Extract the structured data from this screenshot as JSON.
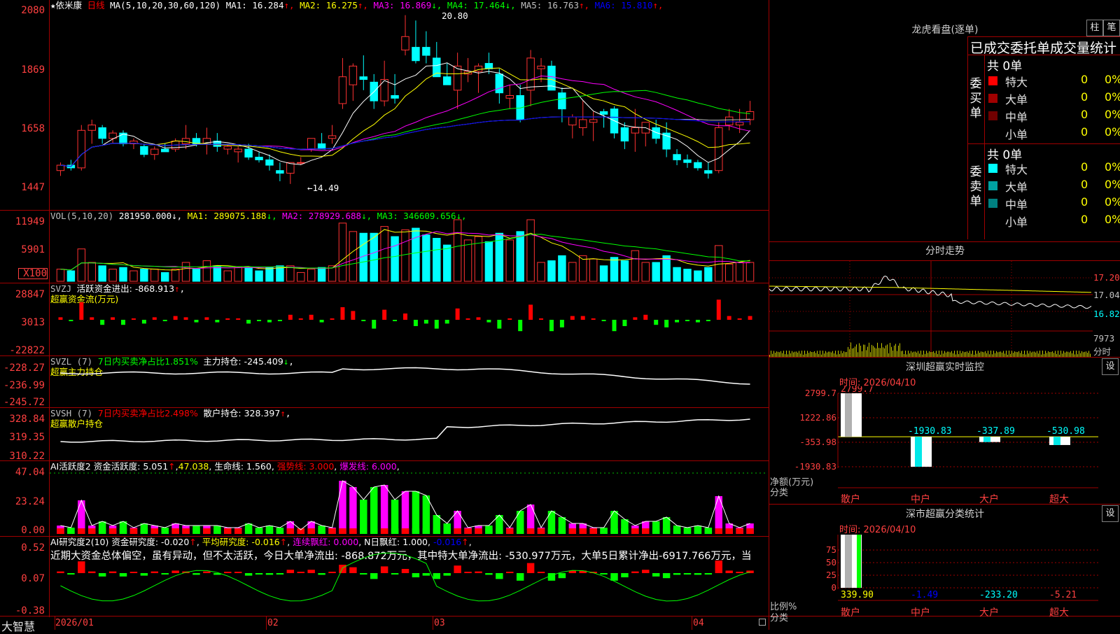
{
  "stock": {
    "star": "★",
    "name": "依米康",
    "period": "日线"
  },
  "main_pane": {
    "y_ticks": [
      "2080",
      "1869",
      "1658",
      "1447"
    ],
    "ma_label": "MA(5,10,20,30,60,120)",
    "ma": [
      {
        "label": "MA1:",
        "value": "16.284",
        "arrow": "↑",
        "color": "#ffffff"
      },
      {
        "label": "MA2:",
        "value": "16.275",
        "arrow": "↑",
        "color": "#ffff00"
      },
      {
        "label": "MA3:",
        "value": "16.869",
        "arrow": "↓",
        "color": "#ff00ff"
      },
      {
        "label": "MA4:",
        "value": "17.464",
        "arrow": "↓",
        "color": "#00ff00"
      },
      {
        "label": "MA5:",
        "value": "16.763",
        "arrow": "↑",
        "color": "#c0c0c0"
      },
      {
        "label": "MA6:",
        "value": "15.810",
        "arrow": "↑",
        "color": "#0000ff"
      }
    ],
    "high_label": "20.80",
    "low_label": "←14.49",
    "ylim": [
      14.0,
      21.0
    ]
  },
  "vol_pane": {
    "y_ticks": [
      "11949",
      "5901",
      "X100"
    ],
    "label": "VOL(5,10,20)",
    "value": "281950.000",
    "ma": [
      {
        "label": "MA1:",
        "value": "289075.188",
        "arrow": "↓",
        "color": "#ffff00"
      },
      {
        "label": "MA2:",
        "value": "278929.688",
        "arrow": "↓",
        "color": "#ff00ff"
      },
      {
        "label": "MA3:",
        "value": "346609.656",
        "arrow": "↓",
        "color": "#00ff00"
      }
    ]
  },
  "svzj_pane": {
    "y_ticks": [
      "28847",
      "3013",
      "-22822"
    ],
    "label": "SVZJ",
    "line1": "活跃资金进出: -868.913",
    "line1_arrow": "↑",
    "line2": "超赢资金流(万元)"
  },
  "svzl_pane": {
    "y_ticks": [
      "-228.27",
      "-236.99",
      "-245.72"
    ],
    "label": "SVZL (7)",
    "ratio": "7日内买卖净占比1.851%",
    "holding": "主力持仓: -245.409",
    "holding_arrow": "↓",
    "line2": "超赢主力持仓"
  },
  "svsh_pane": {
    "y_ticks": [
      "328.84",
      "319.35",
      "310.22"
    ],
    "label": "SVSH (7)",
    "ratio": "7日内买卖净占比2.498%",
    "holding": "散户持仓: 328.397",
    "holding_arrow": "↑",
    "line2": "超赢散户持仓"
  },
  "ai_active_pane": {
    "y_ticks": [
      "47.04",
      "23.24",
      "0.00"
    ],
    "label": "AI活跃度2",
    "activity": "资金活跃度: 5.051",
    "activity_arrow": "↑",
    "v2": "47.038",
    "life": "生命线: 1.560",
    "strong": "强势线: 3.000",
    "burst": "爆发线: 6.000"
  },
  "ai_research_pane": {
    "y_ticks": [
      "0.52",
      "0.07",
      "-0.38"
    ],
    "label": "AI研究度2(10)",
    "research": "资金研究度: -0.020",
    "research_arrow": "↑",
    "avg": "平均研究度: -0.016",
    "avg_arrow": "↑",
    "lianxu": "连续飘红: 0.000",
    "npiao": "N日飘红: 1.000,",
    "last": "-0.016",
    "last_arrow": "↑",
    "comment": "近期大资金总体偏空，虽有异动，但不太活跃，今日大单净流出: -868.872万元，其中特大单净流出: -530.977万元，大单5日累计净出-6917.766万元，当"
  },
  "x_axis": {
    "labels": [
      "2026/01",
      "02",
      "03",
      "04"
    ],
    "brand": "大智慧"
  },
  "right": {
    "lhb_title": "龙虎看盘(逐单)",
    "btn_zhu": "柱",
    "btn_bi": "笔",
    "ob_header": "已成交委托单成交量统计",
    "buy_label": "委买单",
    "sell_label": "委卖单",
    "buy_total": "共 0单",
    "sell_total": "共 0单",
    "buy_rows": [
      {
        "name": "特大",
        "count": "0",
        "pct": "0%",
        "color": "#ff0000"
      },
      {
        "name": "大单",
        "count": "0",
        "pct": "0%",
        "color": "#a00000"
      },
      {
        "name": "中单",
        "count": "0",
        "pct": "0%",
        "color": "#700000"
      },
      {
        "name": "小单",
        "count": "0",
        "pct": "0%",
        "color": ""
      }
    ],
    "sell_rows": [
      {
        "name": "特大",
        "count": "0",
        "pct": "0%",
        "color": "#00ffff"
      },
      {
        "name": "大单",
        "count": "0",
        "pct": "0%",
        "color": "#00a0a0"
      },
      {
        "name": "中单",
        "count": "0",
        "pct": "0%",
        "color": "#008080"
      },
      {
        "name": "小单",
        "count": "0",
        "pct": "0%",
        "color": ""
      }
    ],
    "intraday_title": "分时走势",
    "intraday_ticks": [
      "17.20",
      "17.04",
      "16.82",
      "7973",
      "分时"
    ],
    "sz_monitor_title": "深圳超赢实时监控",
    "btn_set": "设",
    "time_label": "时间: 2026/04/10",
    "monitor_ticks": [
      "2799.7",
      "1222.86",
      "-353.98",
      "-1930.83"
    ],
    "monitor_values": [
      "2799.7",
      "-1930.83",
      "-337.89",
      "-530.98"
    ],
    "y_unit": "净额(万元)",
    "x_unit": "分类",
    "categories": [
      "散户",
      "中户",
      "大户",
      "超大"
    ],
    "sz_class_title": "深市超赢分类统计",
    "class_ticks": [
      "75",
      "50",
      "25",
      "0"
    ],
    "class_values": [
      "339.90",
      "-1.49",
      "-233.20",
      "-5.21"
    ],
    "ratio_unit": "比例%",
    "class_x_unit": "分类"
  },
  "chart_data": [
    {
      "type": "candlestick",
      "name": "",
      "ylim": [
        14.0,
        21.0
      ],
      "x": [
        "2026/01",
        "02",
        "03",
        "04"
      ],
      "ohlc": [
        [
          15.0,
          15.3,
          14.8,
          15.2
        ],
        [
          15.2,
          15.4,
          15.0,
          15.1
        ],
        [
          15.1,
          16.7,
          15.0,
          16.5
        ],
        [
          16.5,
          16.9,
          16.0,
          16.7
        ],
        [
          16.6,
          16.7,
          16.0,
          16.2
        ],
        [
          16.2,
          16.5,
          16.0,
          16.4
        ],
        [
          16.4,
          16.5,
          15.9,
          16.0
        ],
        [
          16.0,
          16.2,
          15.8,
          16.1
        ],
        [
          15.9,
          16.0,
          15.5,
          15.6
        ],
        [
          15.6,
          15.9,
          15.4,
          15.8
        ],
        [
          15.8,
          16.0,
          15.7,
          15.7
        ],
        [
          15.8,
          16.2,
          15.7,
          16.1
        ],
        [
          16.0,
          16.7,
          15.8,
          16.2
        ],
        [
          16.2,
          16.4,
          15.9,
          16.0
        ],
        [
          16.0,
          16.6,
          15.6,
          16.2
        ],
        [
          16.1,
          16.4,
          15.7,
          15.9
        ],
        [
          15.8,
          16.0,
          15.6,
          15.9
        ],
        [
          15.7,
          15.9,
          15.3,
          15.8
        ],
        [
          15.8,
          16.0,
          15.4,
          15.5
        ],
        [
          15.5,
          15.7,
          15.3,
          15.4
        ],
        [
          15.4,
          15.6,
          15.0,
          15.2
        ],
        [
          15.0,
          15.3,
          14.6,
          14.9
        ],
        [
          14.9,
          15.2,
          14.5,
          15.3
        ],
        [
          15.3,
          15.5,
          15.2,
          15.3
        ],
        [
          15.8,
          16.2,
          15.7,
          16.2
        ],
        [
          16.0,
          16.4,
          15.8,
          15.8
        ],
        [
          16.2,
          16.7,
          16.0,
          16.3
        ],
        [
          17.5,
          19.2,
          17.3,
          18.5
        ],
        [
          18.2,
          19.0,
          17.6,
          18.9
        ],
        [
          18.5,
          19.3,
          18.0,
          18.4
        ],
        [
          18.3,
          18.6,
          17.3,
          17.6
        ],
        [
          17.6,
          19.1,
          17.4,
          18.4
        ],
        [
          17.8,
          18.6,
          17.5,
          17.7
        ],
        [
          19.5,
          20.8,
          19.3,
          20.0
        ],
        [
          19.6,
          20.6,
          19.0,
          19.1
        ],
        [
          19.6,
          20.2,
          19.0,
          19.3
        ],
        [
          19.2,
          19.8,
          18.8,
          18.5
        ],
        [
          18.5,
          19.0,
          18.4,
          18.2
        ],
        [
          18.0,
          19.4,
          17.3,
          18.9
        ],
        [
          18.6,
          19.2,
          18.3,
          18.7
        ],
        [
          18.7,
          19.0,
          17.9,
          18.9
        ],
        [
          19.0,
          19.4,
          18.6,
          18.8
        ],
        [
          18.6,
          18.8,
          17.5,
          17.9
        ],
        [
          17.7,
          18.2,
          17.3,
          17.8
        ],
        [
          17.8,
          18.2,
          16.8,
          16.9
        ],
        [
          18.0,
          19.5,
          17.4,
          19.2
        ],
        [
          18.8,
          19.2,
          18.3,
          18.9
        ],
        [
          18.9,
          19.1,
          18.1,
          18.0
        ],
        [
          17.9,
          18.1,
          16.8,
          17.3
        ],
        [
          16.7,
          17.1,
          16.2,
          17.0
        ],
        [
          16.6,
          17.6,
          16.3,
          16.9
        ],
        [
          16.8,
          17.2,
          16.1,
          16.9
        ],
        [
          17.2,
          17.3,
          16.6,
          17.1
        ],
        [
          17.3,
          17.4,
          16.2,
          16.4
        ],
        [
          16.6,
          16.8,
          15.8,
          16.1
        ],
        [
          16.4,
          17.3,
          15.7,
          16.6
        ],
        [
          16.4,
          16.8,
          15.9,
          16.8
        ],
        [
          16.6,
          16.9,
          16.0,
          16.2
        ],
        [
          16.4,
          16.8,
          15.5,
          15.8
        ],
        [
          15.6,
          15.8,
          15.2,
          15.4
        ],
        [
          15.4,
          15.6,
          15.1,
          15.3
        ],
        [
          15.3,
          15.4,
          15.0,
          15.1
        ],
        [
          15.0,
          15.3,
          14.7,
          14.9
        ],
        [
          15.0,
          16.8,
          14.9,
          16.6
        ],
        [
          16.7,
          17.3,
          16.5,
          17.0
        ],
        [
          16.7,
          17.3,
          16.4,
          16.8
        ],
        [
          16.9,
          17.6,
          16.7,
          17.2
        ]
      ]
    }
  ]
}
